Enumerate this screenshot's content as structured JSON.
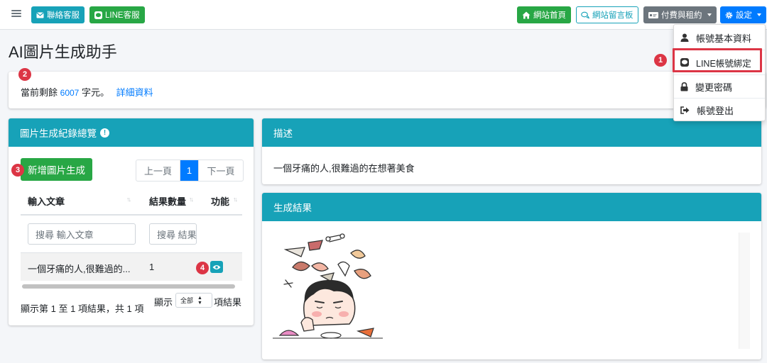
{
  "navbar": {
    "contact_label": "聯絡客服",
    "line_label": "LINE客服",
    "home_label": "網站首頁",
    "board_label": "網站留言板",
    "payment_label": "付費與租約",
    "settings_label": "設定"
  },
  "page": {
    "title": "AI圖片生成助手"
  },
  "info": {
    "prefix": "當前剩餘",
    "remaining": "6007",
    "suffix": "字元。",
    "detail_link": "詳細資料"
  },
  "history": {
    "title": "圖片生成紀錄總覽",
    "new_button": "新增圖片生成",
    "pager": {
      "prev": "上一頁",
      "current": "1",
      "next": "下一頁"
    },
    "columns": [
      "輸入文章",
      "結果數量",
      "功能"
    ],
    "search_placeholders": [
      "搜尋 輸入文章",
      "搜尋 結果數量"
    ],
    "rows": [
      {
        "text": "一個牙痛的人,很難過的...",
        "count": "1"
      }
    ],
    "summary": "顯示第 1 至 1 項結果，共 1 項",
    "show_label": "顯示",
    "show_option": "全部",
    "show_suffix": "項結果"
  },
  "description": {
    "title": "描述",
    "text": "一個牙痛的人,很難過的在想著美食"
  },
  "result": {
    "title": "生成結果"
  },
  "dropdown": {
    "items": [
      "帳號基本資料",
      "LINE帳號綁定",
      "變更密碼",
      "帳號登出"
    ]
  },
  "badges": [
    "1",
    "2",
    "3",
    "4"
  ],
  "colors": {
    "teal": "#17a2b8",
    "green": "#28a745",
    "blue": "#007bff",
    "gray": "#6c757d",
    "red": "#dc3545"
  },
  "icons": [
    "menu-icon",
    "envelope-icon",
    "line-icon",
    "home-icon",
    "chat-icon",
    "card-icon",
    "gear-icon",
    "info-icon",
    "eye-icon",
    "user-icon",
    "lock-icon",
    "logout-icon",
    "sort-icon"
  ]
}
